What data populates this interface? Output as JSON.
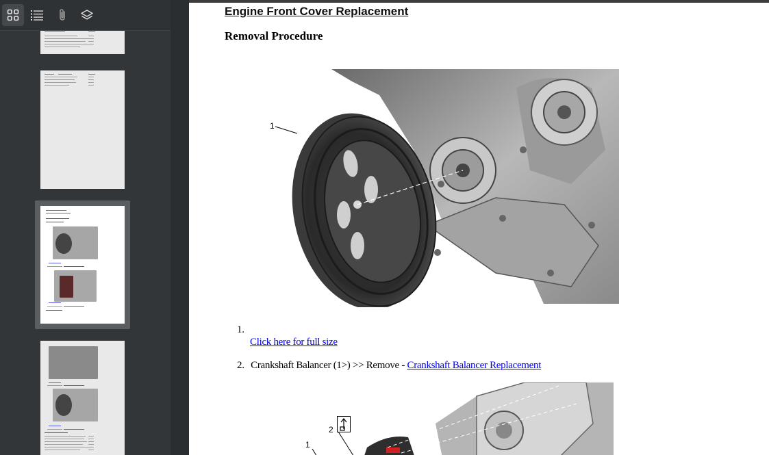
{
  "toolbar": {
    "thumbnails_icon": "grid-icon",
    "outline_icon": "list-icon",
    "attachments_icon": "paperclip-icon",
    "layers_icon": "layers-icon"
  },
  "document": {
    "title": "Engine Front Cover Replacement",
    "subtitle": "Removal Procedure",
    "figure1_callout": "1",
    "steps": [
      {
        "number": "1.",
        "text": "",
        "link": "Click here for full size"
      },
      {
        "number": "2.",
        "text": "Crankshaft Balancer (1>) >> Remove - ",
        "link": "Crankshaft Balancer Replacement"
      }
    ],
    "figure2_callouts": [
      "2",
      "1"
    ]
  },
  "colors": {
    "sidebar_bg": "#333639",
    "link": "#0000ee",
    "selection": "#5b5e61"
  }
}
